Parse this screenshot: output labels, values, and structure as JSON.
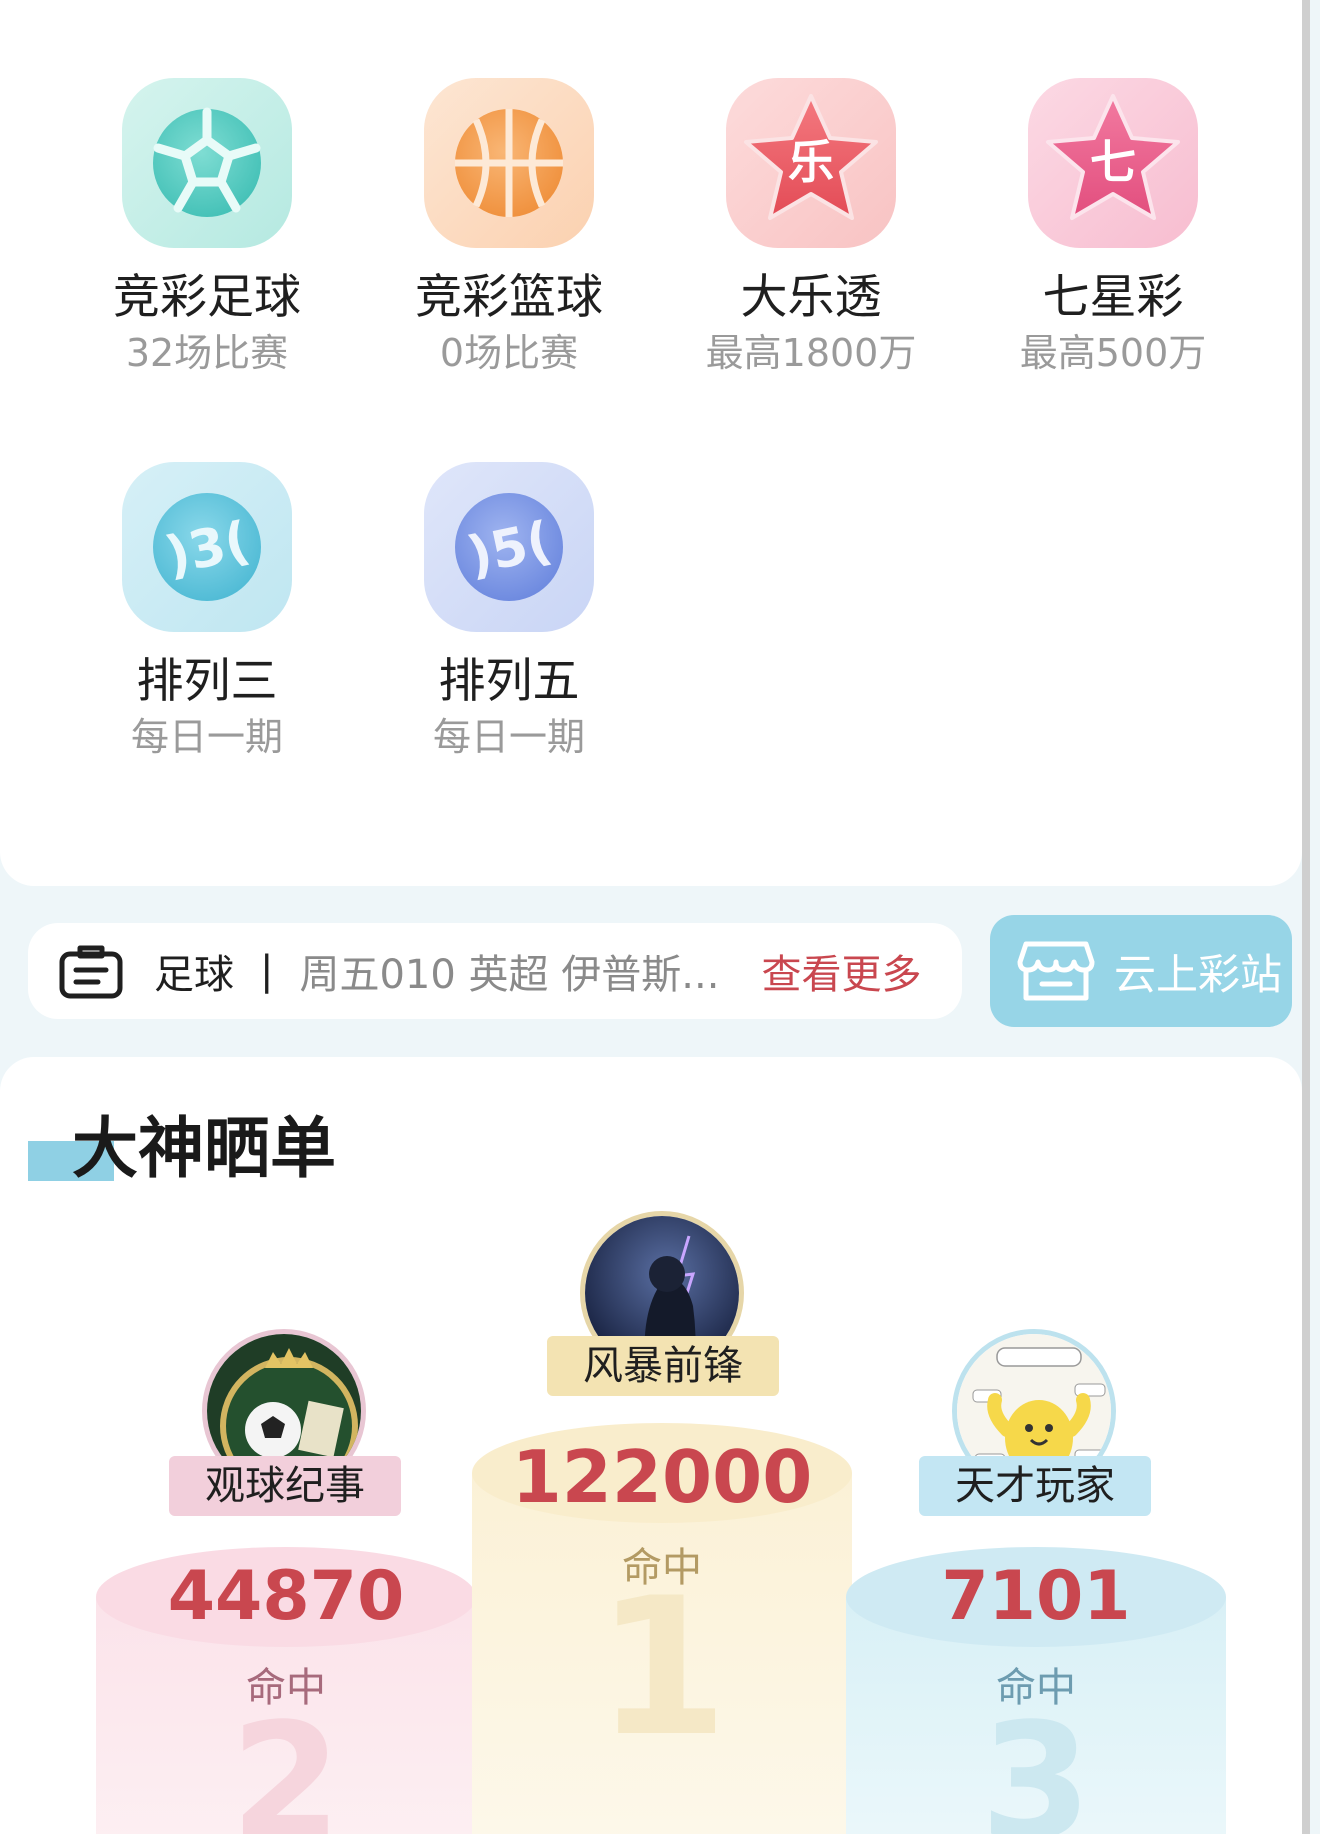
{
  "games": [
    {
      "title": "竞彩足球",
      "sub": "32场比赛",
      "icon": "football-icon"
    },
    {
      "title": "竞彩篮球",
      "sub": "0场比赛",
      "icon": "basketball-icon"
    },
    {
      "title": "大乐透",
      "sub": "最高1800万",
      "icon": "le-star-icon"
    },
    {
      "title": "七星彩",
      "sub": "最高500万",
      "icon": "qi-star-icon"
    },
    {
      "title": "排列三",
      "sub": "每日一期",
      "icon": "ball-3-icon"
    },
    {
      "title": "排列五",
      "sub": "每日一期",
      "icon": "ball-5-icon"
    }
  ],
  "notice": {
    "label": "足球",
    "separator": "|",
    "text": "周五010 英超 伊普斯...",
    "more": "查看更多"
  },
  "station": {
    "label": "云上彩站"
  },
  "section": {
    "title": "大神晒单"
  },
  "leaders": [
    {
      "rank": "1",
      "name": "风暴前锋",
      "score": "122000",
      "hit": "命中"
    },
    {
      "rank": "2",
      "name": "观球纪事",
      "score": "44870",
      "hit": "命中"
    },
    {
      "rank": "3",
      "name": "天才玩家",
      "score": "7101",
      "hit": "命中"
    }
  ],
  "colors": {
    "accent": "#97d5e7",
    "red": "#c9474f"
  }
}
